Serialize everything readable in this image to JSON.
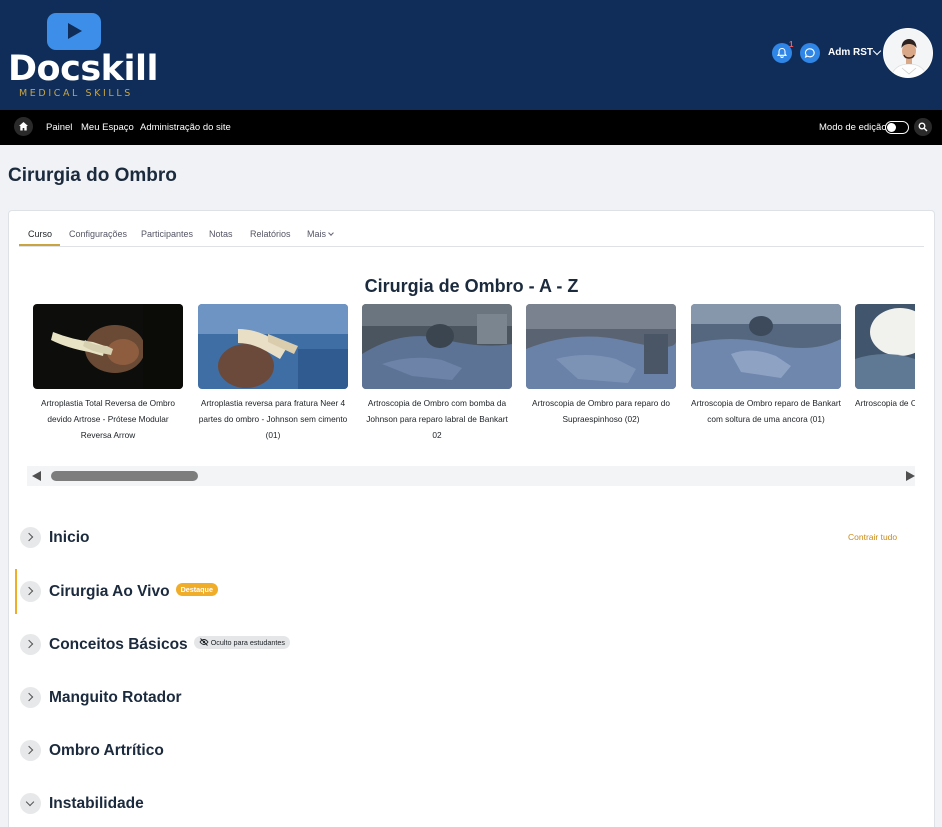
{
  "brand": {
    "name": "Docskill",
    "tagline": "MEDICAL SKILLS",
    "accent": "#0f2d58",
    "gold": "#c9a441"
  },
  "header": {
    "notifications_count": "1",
    "user_name": "Adm RST"
  },
  "nav": {
    "links": [
      "Painel",
      "Meu Espaço",
      "Administração do site"
    ],
    "edit_mode_label": "Modo de edição"
  },
  "page_title": "Cirurgia do Ombro",
  "tabs": [
    "Curso",
    "Configurações",
    "Participantes",
    "Notas",
    "Relatórios",
    "Mais"
  ],
  "carousel": {
    "title": "Cirurgia de Ombro - A - Z",
    "slides": [
      {
        "caption": "Artroplastia Total Reversa de Ombro devido Artrose - Prótese Modular Reversa Arrow"
      },
      {
        "caption": "Artroplastia reversa para fratura Neer 4 partes do ombro - Johnson sem cimento (01)"
      },
      {
        "caption": "Artroscopia de Ombro com bomba da Johnson para reparo labral de Bankart 02"
      },
      {
        "caption": "Artroscopia de Ombro para reparo do Supraespinhoso (02)"
      },
      {
        "caption": "Artroscopia de Ombro reparo de Bankart com soltura de uma ancora (01)"
      },
      {
        "caption": "Artroscopia de Ombro reparo de Bankart"
      }
    ]
  },
  "sections": {
    "collapse_all": "Contrair tudo",
    "items": [
      {
        "title": "Inicio",
        "badge": ""
      },
      {
        "title": "Cirurgia Ao Vivo",
        "badge": "Destaque"
      },
      {
        "title": "Conceitos Básicos",
        "badge": "Oculto para estudantes"
      },
      {
        "title": "Manguito Rotador",
        "badge": ""
      },
      {
        "title": "Ombro Artrítico",
        "badge": ""
      },
      {
        "title": "Instabilidade",
        "badge": ""
      }
    ]
  }
}
